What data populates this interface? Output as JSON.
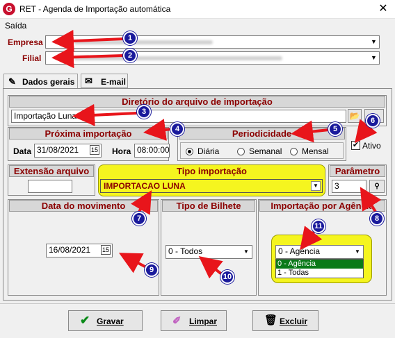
{
  "window": {
    "title": "RET - Agenda de Importação automática",
    "logo_letter": "G",
    "close": "✕"
  },
  "menu": {
    "saida": "Saída"
  },
  "empresa": {
    "label": "Empresa"
  },
  "filial": {
    "label": "Filial"
  },
  "tabs": [
    {
      "label": "Dados gerais",
      "icon": "pencil-icon"
    },
    {
      "label": "E-mail",
      "icon": "email-icon"
    }
  ],
  "diretorio": {
    "header": "Diretório do arquivo de importação",
    "value": "Importação Luna"
  },
  "proxima": {
    "header": "Próxima importação",
    "data_label": "Data",
    "data_value": "31/08/2021",
    "hora_label": "Hora",
    "hora_value": "08:00:00"
  },
  "periodicidade": {
    "header": "Periodicidade",
    "options": [
      "Diária",
      "Semanal",
      "Mensal"
    ],
    "selected": "Diária"
  },
  "ativo": {
    "label": "Ativo",
    "checked": true
  },
  "extensao": {
    "header": "Extensão arquivo",
    "value": ""
  },
  "tipo_importacao": {
    "header": "Tipo importação",
    "value": "IMPORTACAO LUNA"
  },
  "parametro": {
    "header": "Parâmetro",
    "value": "3"
  },
  "data_movimento": {
    "header": "Data do movimento",
    "value": "16/08/2021"
  },
  "tipo_bilhete": {
    "header": "Tipo de Bilhete",
    "value": "0 - Todos"
  },
  "importacao_agencia": {
    "header": "Importação por Agência",
    "value": "0 - Agência",
    "options": [
      "0 - Agência",
      "1 - Todas"
    ]
  },
  "buttons": {
    "gravar": "Gravar",
    "limpar": "Limpar",
    "excluir": "Excluir"
  },
  "callouts": [
    "1",
    "2",
    "3",
    "4",
    "5",
    "6",
    "7",
    "8",
    "9",
    "10",
    "11"
  ],
  "colors": {
    "callout": "#1a1a9c",
    "arrow": "#e8151b",
    "highlight": "#f5f51f",
    "header_text": "#8b0000",
    "selection": "#0a7a18"
  }
}
